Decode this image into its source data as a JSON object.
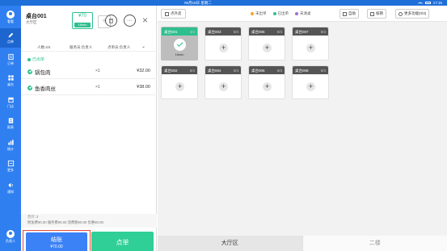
{
  "statusbar": {
    "time": "05月18日 星期二",
    "clock": "17:15"
  },
  "sidebar": {
    "items": [
      {
        "label": "看看",
        "icon": "avatar-icon"
      },
      {
        "label": "点单",
        "icon": "edit-icon"
      },
      {
        "label": "订单",
        "icon": "order-icon"
      },
      {
        "label": "桌台",
        "icon": "table-icon"
      },
      {
        "label": "门店",
        "icon": "store-icon"
      },
      {
        "label": "报表",
        "icon": "report-icon"
      },
      {
        "label": "统计",
        "icon": "stats-icon"
      },
      {
        "label": "更多",
        "icon": "more-icon"
      },
      {
        "label": "通知",
        "icon": "notice-icon"
      }
    ],
    "bottom_user": "负责人"
  },
  "order_panel": {
    "table_name": "桌台001",
    "area": "大厅区",
    "price": "¥70",
    "duration": "16min",
    "headers": {
      "people": "人数:4/4",
      "waiter": "服务员:负责人",
      "orderer": "点单员:负责人"
    },
    "status": "已出单",
    "dishes": [
      {
        "name": "锅包肉",
        "qty": "×1",
        "price": "¥32.00"
      },
      {
        "name": "鱼香肉丝",
        "qty": "×1",
        "price": "¥38.00"
      }
    ],
    "footer": {
      "total_line": "合计: 2",
      "fees_line": "附加费¥0.00  服务费¥0.00  消费税¥0.00  优惠¥0.00"
    },
    "checkout_label": "结账",
    "checkout_amount": "¥70.00",
    "order_label": "点单"
  },
  "toolbar": {
    "takeout": "点外卖",
    "legend": [
      {
        "label": "未出单",
        "color": "#f5a623"
      },
      {
        "label": "已出单",
        "color": "#2fbf8f"
      },
      {
        "label": "未清桌",
        "color": "#a36bd9"
      }
    ],
    "buttons": [
      "自助",
      "核销",
      "更多功能(0/3)"
    ]
  },
  "tables": [
    {
      "name": "桌台001",
      "cap": "4/4",
      "selected": true,
      "time": "16min"
    },
    {
      "name": "桌台003",
      "cap": "0/4"
    },
    {
      "name": "桌台005",
      "cap": "0/4"
    },
    {
      "name": "桌台007",
      "cap": "0/4"
    },
    {
      "name": "桌台002",
      "cap": "0/4"
    },
    {
      "name": "桌台004",
      "cap": "0/4"
    },
    {
      "name": "桌台006",
      "cap": "0/4"
    },
    {
      "name": "桌台008",
      "cap": "0/4"
    }
  ],
  "area_tabs": [
    "大厅区",
    "二楼"
  ]
}
